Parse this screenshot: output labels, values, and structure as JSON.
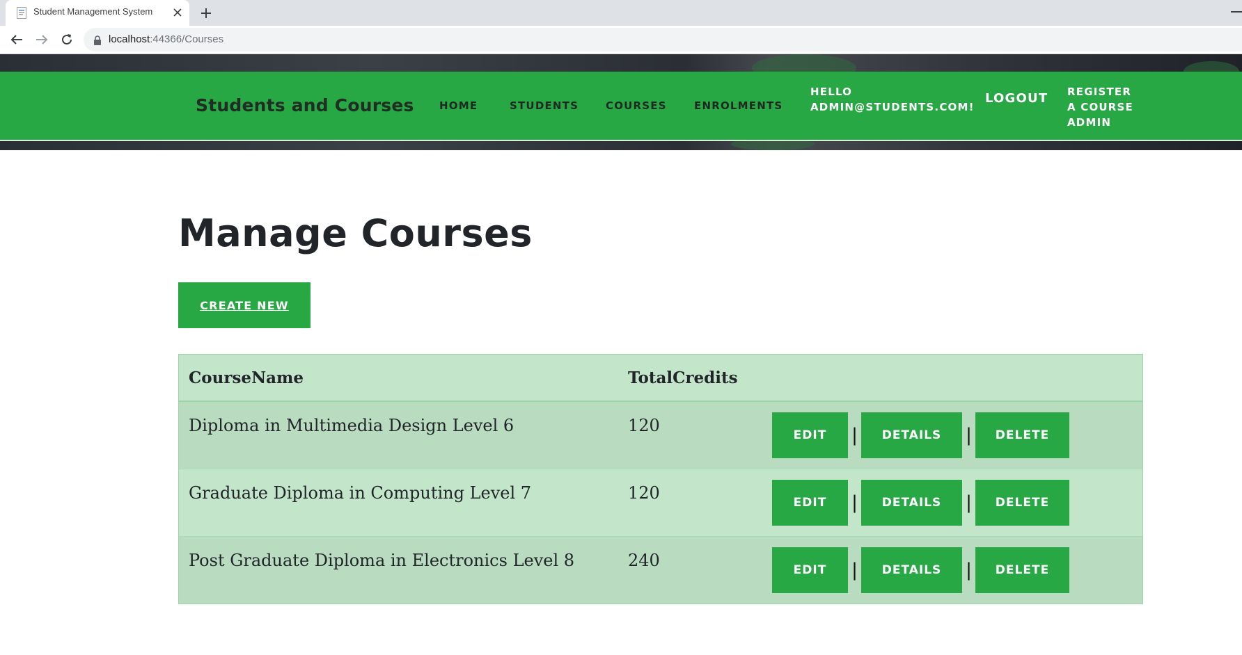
{
  "browser": {
    "tab_title": "Student Management System",
    "url_host": "localhost",
    "url_rest": ":44366/Courses"
  },
  "site": {
    "brand": "Students and Courses",
    "nav": {
      "home": "HOME",
      "students": "STUDENTS",
      "courses": "COURSES",
      "enrolments": "ENROLMENTS",
      "hello_line1": "HELLO",
      "hello_line2": "ADMIN@STUDENTS.COM!",
      "logout": "LOGOUT",
      "register_line1": "REGISTER",
      "register_line2": "A COURSE",
      "register_line3": "ADMIN"
    }
  },
  "main": {
    "title": "Manage Courses",
    "create_label": "CREATE NEW",
    "table": {
      "headers": [
        "CourseName",
        "TotalCredits"
      ],
      "rows": [
        {
          "name": "Diploma in Multimedia Design Level 6",
          "credits": "120"
        },
        {
          "name": "Graduate Diploma in Computing Level 7",
          "credits": "120"
        },
        {
          "name": "Post Graduate Diploma in Electronics Level 8",
          "credits": "240"
        }
      ],
      "actions": {
        "edit": "EDIT",
        "details": "DETAILS",
        "delete": "DELETE",
        "separator": "|"
      }
    }
  },
  "colors": {
    "accent": "#28a745",
    "table_header": "#c3e6cb",
    "table_row_alt": "#b9dbc0"
  }
}
